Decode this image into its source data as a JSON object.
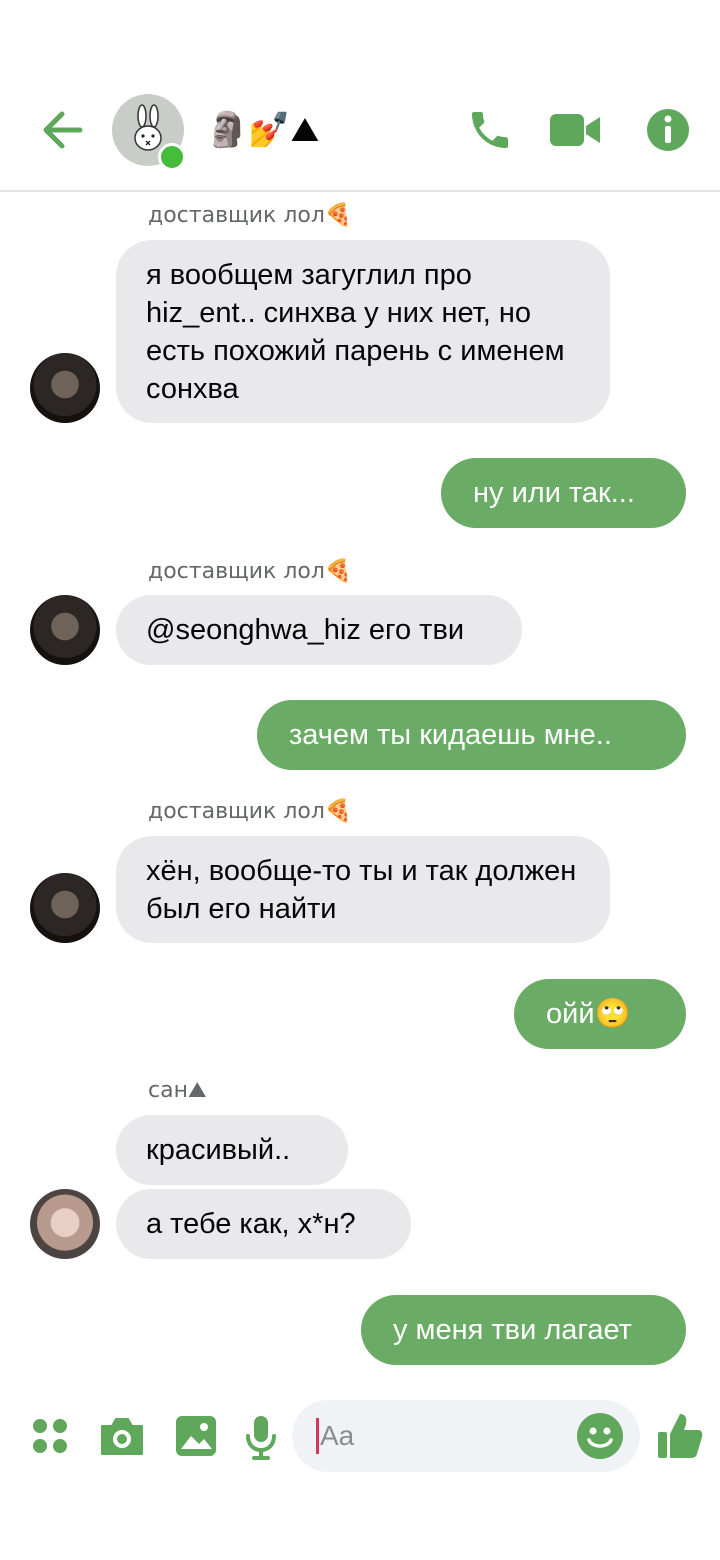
{
  "header": {
    "back_icon": "arrow-left-icon",
    "group_avatar_icon": "bunny-icon",
    "title": "🗿💅⛰",
    "call_icon": "phone-icon",
    "video_icon": "video-camera-icon",
    "info_icon": "info-icon"
  },
  "messages": [
    {
      "sender": "доставщик лол🍕",
      "text": "я вообщем загуглил про hiz_ent.. синхва у них нет, но есть похожий парень с именем сонхва"
    },
    {
      "text": "ну или так..."
    },
    {
      "sender": "доставщик лол🍕",
      "text": "@seonghwa_hiz его тви"
    },
    {
      "text": "зачем ты кидаешь мне.."
    },
    {
      "sender": "доставщик лол🍕",
      "text": "хён, вообще-то ты и так должен был его найти"
    },
    {
      "text": "ойй🙄"
    },
    {
      "sender": "сан⛰",
      "text": "красивый.."
    },
    {
      "text": "а тебе как, х*н?"
    },
    {
      "text": "у меня тви лагает"
    }
  ],
  "composer": {
    "placeholder": "Aa",
    "icons": [
      "menu-dots-icon",
      "camera-icon",
      "image-icon",
      "microphone-icon",
      "emoji-icon",
      "thumbs-up-icon"
    ]
  },
  "colors": {
    "accent": "#5fa75b",
    "outgoing_bubble": "#6aab66",
    "incoming_bubble": "#e9e9eb",
    "online": "#45bd3a"
  }
}
